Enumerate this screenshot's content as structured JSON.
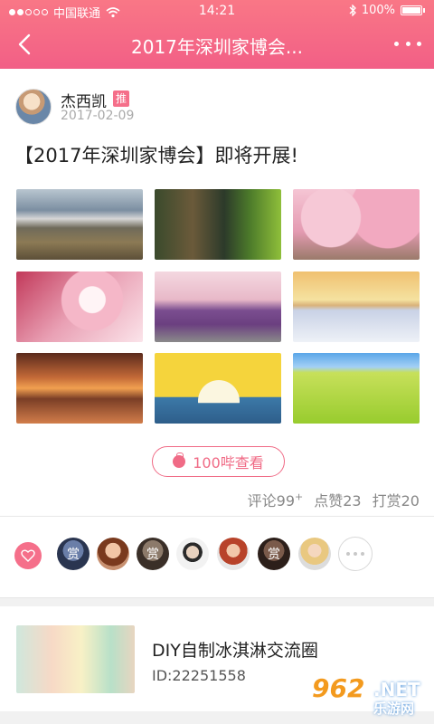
{
  "status_bar": {
    "carrier": "中国联通",
    "time": "14:21",
    "battery": "100%"
  },
  "nav": {
    "title": "2017年深圳家博会..."
  },
  "post": {
    "username": "杰西凯",
    "tag": "推",
    "date": "2017-02-09",
    "title": "【2017年深圳家博会】即将开展!"
  },
  "images": [
    "mountain",
    "street",
    "blossom",
    "tree",
    "train",
    "snow",
    "lake",
    "sun",
    "field"
  ],
  "actions": {
    "view_button": "100哔查看",
    "comments_label": "评论99",
    "comments_plus": "+",
    "likes": "点赞23",
    "rewards": "打赏20"
  },
  "likers": {
    "reward_label": "赏"
  },
  "group": {
    "name": "DIY自制冰淇淋交流圈",
    "id": "ID:22251558"
  },
  "watermark": {
    "logo": "962",
    "net": ".NET",
    "cn": "乐游网"
  }
}
